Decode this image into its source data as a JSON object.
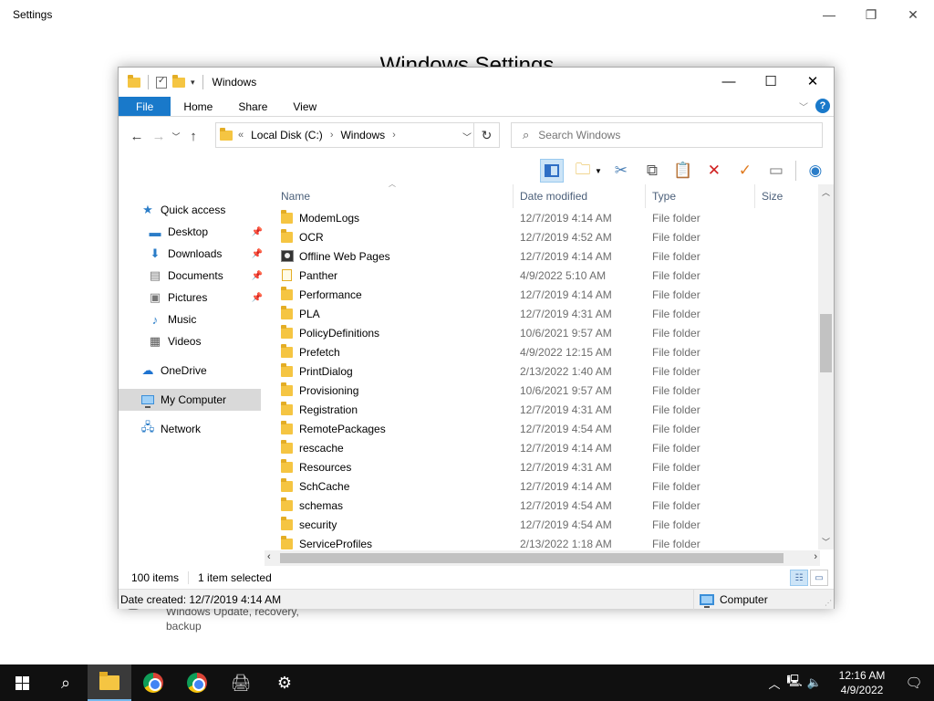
{
  "settings": {
    "title": "Settings",
    "heading": "Windows Settings",
    "bottom_sub": [
      "Windows Update, recovery,",
      "backup"
    ]
  },
  "window": {
    "title": "Windows",
    "controls": {
      "minimize": "—",
      "maximize": "☐",
      "close": "✕"
    }
  },
  "ribbon": {
    "tabs": [
      "File",
      "Home",
      "Share",
      "View"
    ],
    "help": "?"
  },
  "address": {
    "chevrons": "«",
    "crumbs": [
      "Local Disk (C:)",
      "Windows"
    ],
    "search_placeholder": "Search Windows"
  },
  "nav_pane": {
    "quick_access": "Quick access",
    "items": [
      {
        "label": "Desktop",
        "pinned": true
      },
      {
        "label": "Downloads",
        "pinned": true
      },
      {
        "label": "Documents",
        "pinned": true
      },
      {
        "label": "Pictures",
        "pinned": true
      },
      {
        "label": "Music",
        "pinned": false
      },
      {
        "label": "Videos",
        "pinned": false
      }
    ],
    "onedrive": "OneDrive",
    "my_computer": "My Computer",
    "network": "Network"
  },
  "columns": {
    "name": "Name",
    "date": "Date modified",
    "type": "Type",
    "size": "Size"
  },
  "files": [
    {
      "name": "ModemLogs",
      "date": "12/7/2019 4:14 AM",
      "type": "File folder"
    },
    {
      "name": "OCR",
      "date": "12/7/2019 4:52 AM",
      "type": "File folder"
    },
    {
      "name": "Offline Web Pages",
      "date": "12/7/2019 4:14 AM",
      "type": "File folder"
    },
    {
      "name": "Panther",
      "date": "4/9/2022 5:10 AM",
      "type": "File folder"
    },
    {
      "name": "Performance",
      "date": "12/7/2019 4:14 AM",
      "type": "File folder"
    },
    {
      "name": "PLA",
      "date": "12/7/2019 4:31 AM",
      "type": "File folder"
    },
    {
      "name": "PolicyDefinitions",
      "date": "10/6/2021 9:57 AM",
      "type": "File folder"
    },
    {
      "name": "Prefetch",
      "date": "4/9/2022 12:15 AM",
      "type": "File folder"
    },
    {
      "name": "PrintDialog",
      "date": "2/13/2022 1:40 AM",
      "type": "File folder"
    },
    {
      "name": "Provisioning",
      "date": "10/6/2021 9:57 AM",
      "type": "File folder"
    },
    {
      "name": "Registration",
      "date": "12/7/2019 4:31 AM",
      "type": "File folder"
    },
    {
      "name": "RemotePackages",
      "date": "12/7/2019 4:54 AM",
      "type": "File folder"
    },
    {
      "name": "rescache",
      "date": "12/7/2019 4:14 AM",
      "type": "File folder"
    },
    {
      "name": "Resources",
      "date": "12/7/2019 4:31 AM",
      "type": "File folder"
    },
    {
      "name": "SchCache",
      "date": "12/7/2019 4:14 AM",
      "type": "File folder"
    },
    {
      "name": "schemas",
      "date": "12/7/2019 4:54 AM",
      "type": "File folder"
    },
    {
      "name": "security",
      "date": "12/7/2019 4:54 AM",
      "type": "File folder"
    },
    {
      "name": "ServiceProfiles",
      "date": "2/13/2022 1:18 AM",
      "type": "File folder"
    }
  ],
  "status": {
    "item_count": "100 items",
    "selected": "1 item selected",
    "detail": "Date created: 12/7/2019 4:14 AM",
    "location": "Computer"
  },
  "taskbar": {
    "time": "12:16 AM",
    "date": "4/9/2022"
  },
  "colors": {
    "accent": "#1979ca",
    "folder": "#f5c542",
    "selection": "#cce4f7"
  }
}
